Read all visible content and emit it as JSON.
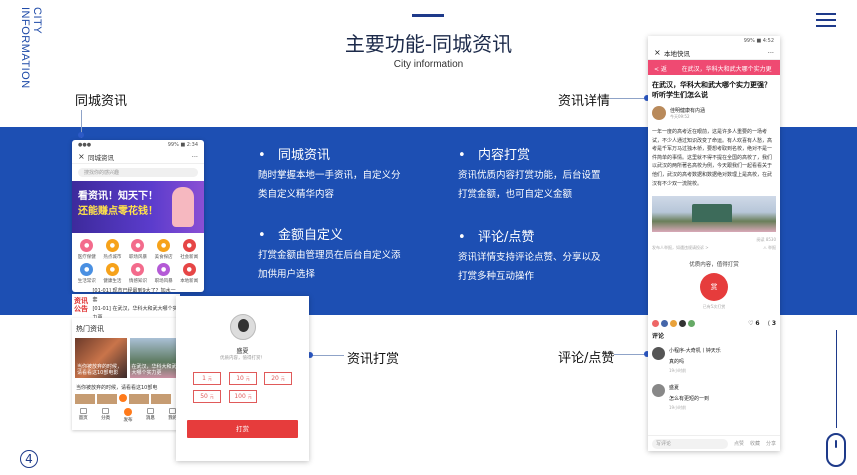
{
  "side_title": {
    "line1": "CITY",
    "line2": "INFORMATION"
  },
  "header": {
    "title": "主要功能-同城资讯",
    "subtitle": "City information"
  },
  "labels": {
    "news": "同城资讯",
    "detail": "资讯详情",
    "reward": "资讯打赏",
    "comment": "评论/点赞"
  },
  "features": [
    {
      "title": "同城资讯",
      "desc": "随时掌握本地一手资讯，自定义分类自定义精华内容"
    },
    {
      "title": "内容打赏",
      "desc": "资讯优质内容打赏功能，后台设置打赏金额，也可自定义金额"
    },
    {
      "title": "金额自定义",
      "desc": "打赏金额由管理员在后台自定义添加供用户选择"
    },
    {
      "title": "评论/点赞",
      "desc": "资讯详情支持评论点赞、分享以及打赏多种互动操作"
    }
  ],
  "phone_news": {
    "status_left": "●●●",
    "status_right": "99% ■ 2:34",
    "nav_title": "同城资讯",
    "search_placeholder": "搜找你的感兴趣",
    "banner_line1": "看资讯！知天下！",
    "banner_line2": "还能赚点零花钱！",
    "icons": [
      {
        "label": "医疗保健",
        "color": "#f36b8c"
      },
      {
        "label": "热点城市",
        "color": "#f6a21b"
      },
      {
        "label": "职场风暴",
        "color": "#f36b8c"
      },
      {
        "label": "美食探店",
        "color": "#f6a21b"
      },
      {
        "label": "社会新闻",
        "color": "#e64646"
      },
      {
        "label": "生活常识",
        "color": "#4a90e2"
      },
      {
        "label": "健康生活",
        "color": "#f6a21b"
      },
      {
        "label": "情感知识",
        "color": "#f36b8c"
      },
      {
        "label": "职场风暴",
        "color": "#b45ad6"
      },
      {
        "label": "本地新闻",
        "color": "#e64646"
      }
    ],
    "news_logo": "资讯公告",
    "news_lines": [
      "[01-01] 现市已经最到9大了？加水一套",
      "[01-01] 在武汉，华科大和武大哪个实力更"
    ],
    "hot_title": "热门资讯",
    "hot_items": [
      {
        "caption": "当你被放弃的时候，请看看这10部电影"
      },
      {
        "caption": "在武汉，华科大和武大哪个实力更"
      }
    ],
    "bottom_text": "当你被放弃的时候，请看看这10部电",
    "tabs": [
      "首页",
      "分类",
      "发布",
      "消息",
      "我的"
    ]
  },
  "reward_card": {
    "name": "盛夏",
    "desc": "优质内容，值得打赏！",
    "amounts": [
      {
        "value": "1",
        "unit": "元"
      },
      {
        "value": "10",
        "unit": "元"
      },
      {
        "value": "20",
        "unit": "元"
      },
      {
        "value": "50",
        "unit": "元"
      },
      {
        "value": "100",
        "unit": "元"
      }
    ],
    "button": "打赏"
  },
  "phone_detail": {
    "status_right": "99% ■ 4:52",
    "nav_title": "本地快讯",
    "red_back": "< 返回",
    "red_title": "在武汉，华科大和武大哪个实力更强?",
    "article_title": "在武汉，华科大和武大哪个实力更强？听听学生们怎么说",
    "author": "佳明健康有内涵",
    "author_time": "今天09:52",
    "body": "一年一度的高考近在眼前，这是许多人重要的一场考试，不少人通过知识改变了命运。有人欢喜有人愁，高考是千军万马过独木桥，要想考取到名校，绝对不是一件简单的事情。这里就不得不提在全国的高校了，我们以武汉的两所著名高校为例，今天跟我们一起看看关于他们，武汉的高考数据和数据绝对数理上是高校，在武汉有不少双一流院校。",
    "img_caption": "阅读 8530",
    "foot_left": "发布人举报，如遇违规请投诉 >",
    "foot_right": "⚠ 举报",
    "reward_text": "优质内容，值得打赏",
    "reward_button": "赏",
    "reward_count": "已有5次打赏",
    "like_count": "6",
    "share_count": "3",
    "comment_header": "评论",
    "comments": [
      {
        "name": "小程序-大奇机丨钟天乐",
        "text": "真的吗",
        "time": "19小时前",
        "avatar": "#555"
      },
      {
        "name": "盛夏",
        "text": "怎么有更短的一到",
        "time": "19小时前",
        "avatar": "#888"
      }
    ],
    "reply_placeholder": "写评论",
    "reply_actions": [
      "点赞",
      "收藏",
      "分享"
    ]
  },
  "page_number": "4"
}
